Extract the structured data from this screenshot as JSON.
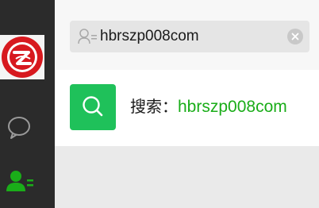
{
  "sidebar": {
    "avatar_icon": "red-circular-logo",
    "items": [
      {
        "name": "chat",
        "icon": "chat-bubble-icon"
      },
      {
        "name": "contacts",
        "icon": "contacts-icon",
        "active_color": "#1aad19"
      }
    ]
  },
  "search": {
    "value": "hbrszp008com",
    "icon": "person-search-icon",
    "clear_icon": "clear-icon"
  },
  "result": {
    "prefix": "搜索：",
    "query": "hbrszp008com",
    "icon": "search-icon",
    "accent_color": "#1fc15a"
  }
}
